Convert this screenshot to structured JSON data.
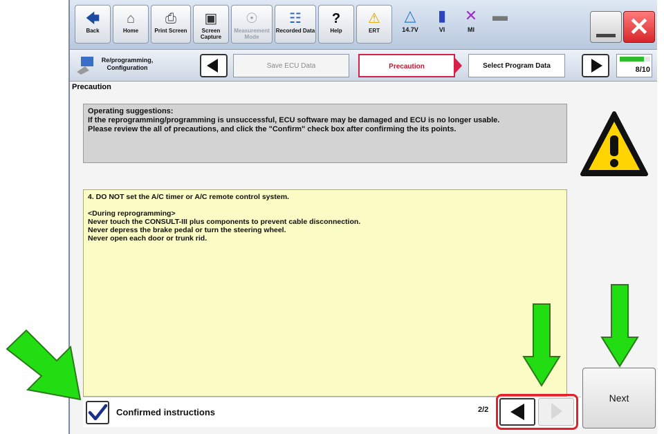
{
  "toolbar": {
    "back_label": "Back",
    "home_label": "Home",
    "print_screen_label": "Print Screen",
    "screen_capture_label": "Screen Capture",
    "measurement_mode_label": "Measurement Mode",
    "recorded_data_label": "Recorded Data",
    "help_label": "Help",
    "ert_label": "ERT",
    "voltage": "14.7V",
    "vi_label": "VI",
    "mi_label": "MI"
  },
  "stepbar": {
    "module_label": "Re/programming, Configuration",
    "step_prev": "Save ECU Data",
    "step_current": "Precaution",
    "step_next": "Select Program Data",
    "progress": "8/10",
    "progress_fraction": 0.8
  },
  "content": {
    "section_title": "Precaution",
    "suggestions_heading": "Operating suggestions:",
    "suggestions_line1": "If the reprogramming/programming is unsuccessful, ECU software may be damaged and ECU is no longer usable.",
    "suggestions_line2": "Please review the all of precautions, and click the \"Confirm\" check box after confirming the its points.",
    "precaution_item": "4. DO NOT set the A/C timer or A/C remote control system.",
    "during_heading": "<During reprogramming>",
    "during_line1": "Never touch the CONSULT-III plus components to prevent cable disconnection.",
    "during_line2": "Never depress the brake pedal or turn the steering wheel.",
    "during_line3": "Never open each door or trunk rid."
  },
  "footer": {
    "confirm_label": "Confirmed instructions",
    "confirmed": true,
    "page_indicator": "2/2",
    "next_label": "Next"
  },
  "colors": {
    "highlight_red": "#e0202a",
    "arrow_green": "#22dd11",
    "warning_yellow": "#ffd400"
  }
}
